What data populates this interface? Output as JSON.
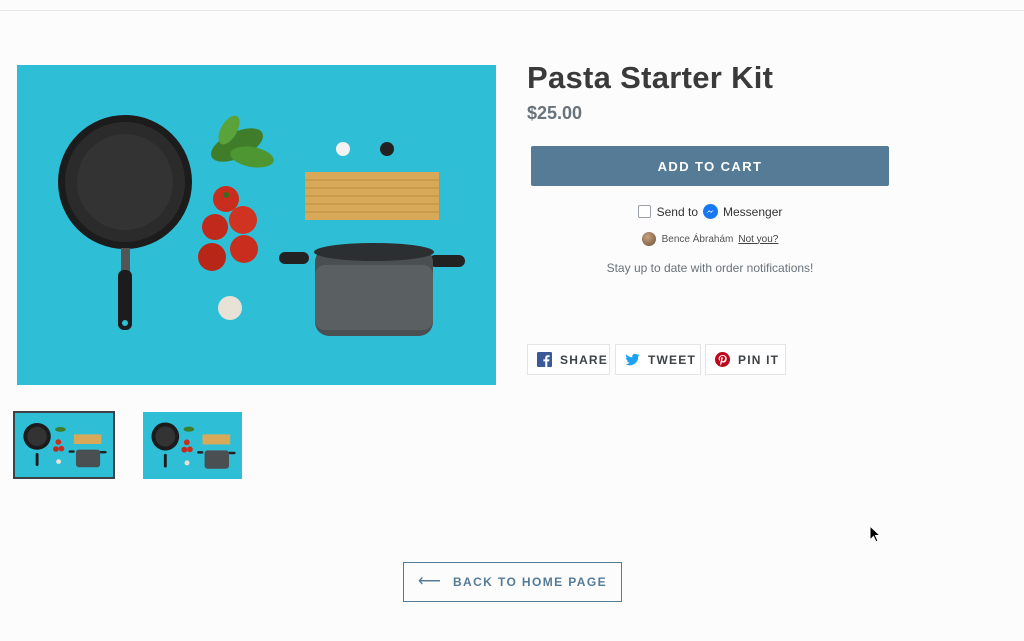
{
  "product": {
    "title": "Pasta Starter Kit",
    "price": "$25.00",
    "add_to_cart_label": "ADD TO CART"
  },
  "messenger": {
    "send_to_label": "Send to",
    "messenger_label": "Messenger",
    "user_name": "Bence Ábrahám",
    "not_you_label": "Not you?",
    "notify_text": "Stay up to date with order notifications!"
  },
  "social": {
    "share_label": "SHARE",
    "tweet_label": "TWEET",
    "pin_label": "PIN IT"
  },
  "navigation": {
    "back_label": "BACK TO HOME PAGE",
    "back_arrow": "⟵"
  },
  "colors": {
    "accent": "#557b97",
    "image_background": "#2ebfd6",
    "facebook": "#3b5998",
    "twitter": "#1da1f2",
    "pinterest": "#bd081c"
  },
  "icons": [
    "facebook-icon",
    "twitter-icon",
    "pinterest-icon",
    "messenger-icon",
    "arrow-left-icon"
  ]
}
